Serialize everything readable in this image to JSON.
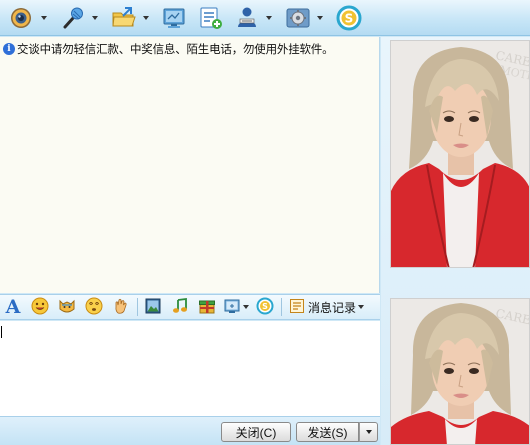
{
  "toolbar": {
    "items": [
      {
        "name": "video-call",
        "icon": "webcam-icon"
      },
      {
        "name": "voice-call",
        "icon": "microphone-icon"
      },
      {
        "name": "send-file",
        "icon": "folder-icon"
      },
      {
        "name": "remote-desktop",
        "icon": "monitor-icon"
      },
      {
        "name": "create-discussion",
        "icon": "add-note-icon"
      },
      {
        "name": "user-info",
        "icon": "contact-card-icon"
      },
      {
        "name": "app-settings",
        "icon": "gear-icon"
      },
      {
        "name": "app-s",
        "icon": "s-logo-icon"
      }
    ]
  },
  "chat": {
    "notice": "交谈中请勿轻信汇款、中奖信息、陌生电话，勿使用外挂软件。"
  },
  "format_toolbar": {
    "history_label": "消息记录"
  },
  "input": {
    "value": ""
  },
  "buttons": {
    "close_label": "关闭(C)",
    "send_label": "发送(S)"
  },
  "colors": {
    "toolbar_bg": "#c8e6f7",
    "chat_bg": "#fbfbf3",
    "accent_blue": "#2f6fd8",
    "hoodie_red": "#d7282d"
  }
}
